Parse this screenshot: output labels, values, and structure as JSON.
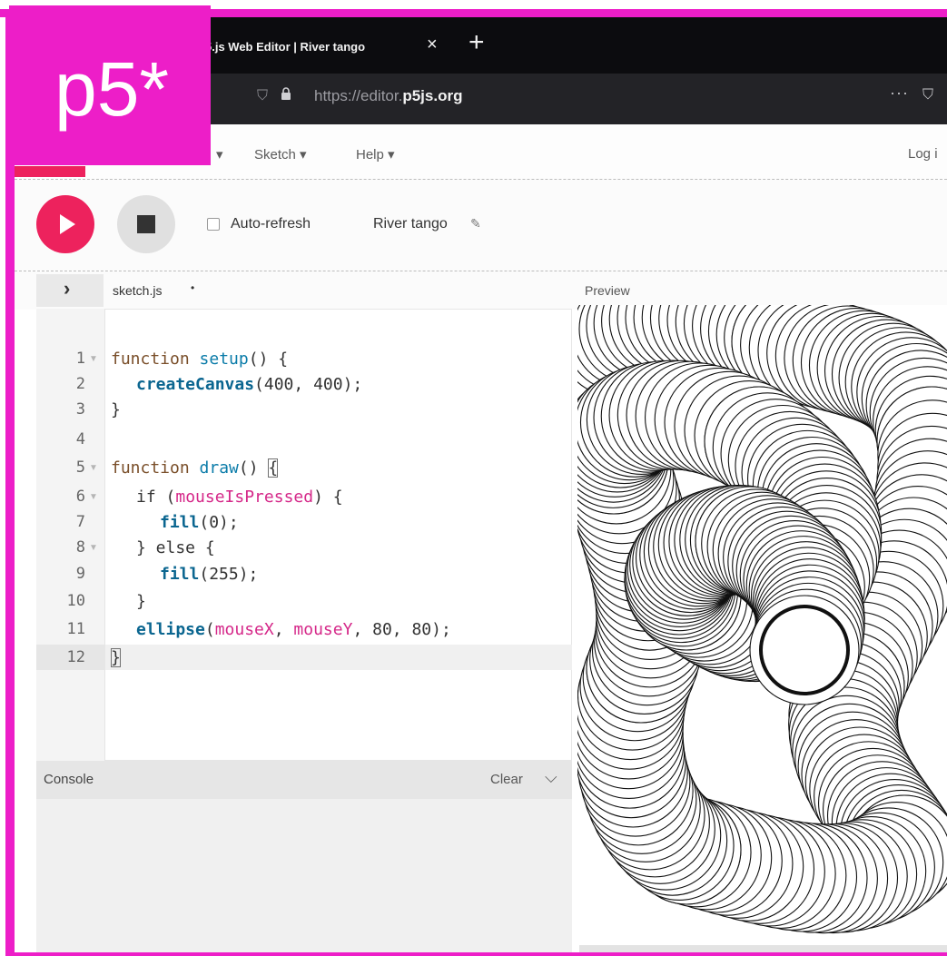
{
  "logo": {
    "text": "p5*"
  },
  "browser": {
    "tab_title": "p5.js Web Editor | River tango",
    "tab_title_visible": "5.js Web Editor | River tango",
    "tab_close": "×",
    "new_tab": "+",
    "url_prefix": "https://editor.",
    "url_domain": "p5js.org",
    "overflow": "···"
  },
  "menu": {
    "sketch": "Sketch",
    "help": "Help",
    "login": "Log i",
    "arrow": "▾"
  },
  "toolbar": {
    "auto_refresh_label": "Auto-refresh",
    "auto_refresh_checked": false,
    "sketch_name": "River tango"
  },
  "editor": {
    "file_tab": "sketch.js",
    "unsaved_marker": "•",
    "collapse_arrow": "›",
    "preview_label": "Preview",
    "line_numbers": [
      "1",
      "2",
      "3",
      "4",
      "5",
      "6",
      "7",
      "8",
      "9",
      "10",
      "11",
      "12"
    ],
    "lines": [
      [
        "function ",
        "setup",
        "() {"
      ],
      [
        "createCanvas",
        "(400, 400);"
      ],
      [
        "}"
      ],
      [
        ""
      ],
      [
        "function ",
        "draw",
        "() ",
        "{"
      ],
      [
        "if (",
        "mouseIsPressed",
        ") {"
      ],
      [
        "fill",
        "(0);"
      ],
      [
        "} else {"
      ],
      [
        "fill",
        "(255);"
      ],
      [
        "}"
      ],
      [
        "ellipse",
        "(",
        "mouseX",
        ", ",
        "mouseY",
        ", 80, 80);"
      ],
      [
        "}"
      ]
    ]
  },
  "console": {
    "label": "Console",
    "clear_label": "Clear"
  },
  "colors": {
    "brand_magenta": "#ed1ec8",
    "p5_pink": "#ed225d",
    "keyword": "#7a4f2a",
    "function": "#0b7ca9",
    "variable": "#d52889"
  },
  "icons": {
    "play": "play-icon",
    "stop": "stop-icon",
    "pencil": "pencil-icon",
    "shield": "shield-icon",
    "lock": "lock-icon",
    "chevron": "chevron-down-icon"
  }
}
